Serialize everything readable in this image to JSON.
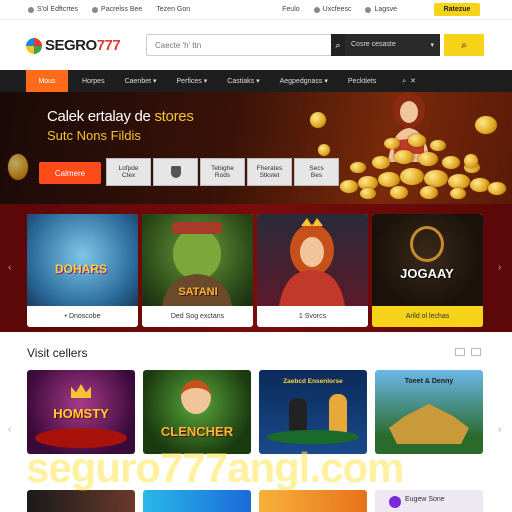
{
  "topbar": {
    "items": [
      "S'ol Edftcrtes",
      "Pacrelss Bee",
      "Tezen Gon"
    ],
    "right_items": [
      "Feulo",
      "Uxcfeesc",
      "Lagsve"
    ],
    "yellow_button": "Ratezue"
  },
  "header": {
    "logo_text": "SEGRO",
    "logo_num": "777",
    "search_placeholder": "Caecte 'h' ttn",
    "select_value": "Cosre cesaste"
  },
  "nav": {
    "items": [
      "Mous",
      "Horpes",
      "Caenbet",
      "Perfices",
      "Castiaks",
      "Aegpedgnass",
      "Pecktiets"
    ]
  },
  "hero": {
    "title_a": "Calek ertalay de ",
    "title_b": "stores",
    "subtitle": "Sutc Nons Fildis",
    "cta": "Calmere",
    "chips": [
      {
        "l1": "Lofpde",
        "l2": "Ctex"
      },
      {
        "l1": "",
        "l2": ""
      },
      {
        "l1": "Tebighe",
        "l2": "Rods"
      },
      {
        "l1": "Fherates",
        "l2": "Stkstet"
      },
      {
        "l1": "Secs",
        "l2": "Bes"
      }
    ]
  },
  "featured": [
    {
      "title": "DOHARS",
      "label": "Dnoscobe"
    },
    {
      "title": "SATANI",
      "label": "Ded Sog exctans"
    },
    {
      "title": "",
      "label": "Svorcs"
    },
    {
      "title": "JOGAAY",
      "label": "Arild ol lechas"
    }
  ],
  "section": {
    "title": "Visit cellers"
  },
  "grid": [
    {
      "title": "HOMSTY"
    },
    {
      "title": "CLENCHER"
    },
    {
      "title": "Zaebcd Ensenlorse"
    },
    {
      "title": "Toeet & Denny"
    }
  ],
  "bottom_row": [
    "",
    "",
    "",
    "Eugew Sone"
  ],
  "watermark": "seguro777angl.com",
  "colors": {
    "accent": "#ff6b1a",
    "yellow": "#f6d219",
    "dark": "#1e1e1e",
    "red": "#7a0c0c"
  }
}
